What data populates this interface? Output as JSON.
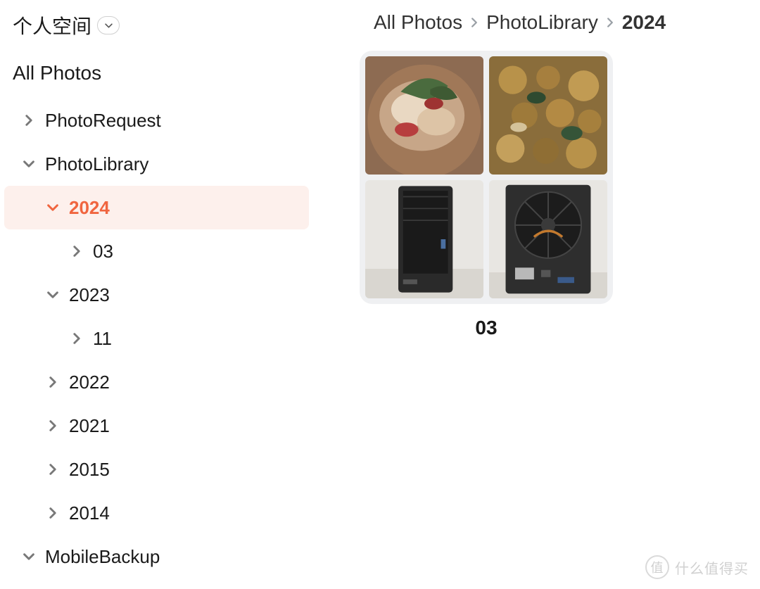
{
  "header": {
    "space_label": "个人空间"
  },
  "sidebar": {
    "root": "All Photos",
    "items": [
      {
        "label": "PhotoRequest",
        "expanded": false,
        "level": 1,
        "active": false
      },
      {
        "label": "PhotoLibrary",
        "expanded": true,
        "level": 1,
        "active": false
      },
      {
        "label": "2024",
        "expanded": true,
        "level": 2,
        "active": true
      },
      {
        "label": "03",
        "expanded": false,
        "level": 3,
        "active": false
      },
      {
        "label": "2023",
        "expanded": true,
        "level": 2,
        "active": false
      },
      {
        "label": "11",
        "expanded": false,
        "level": 3,
        "active": false
      },
      {
        "label": "2022",
        "expanded": false,
        "level": 2,
        "active": false
      },
      {
        "label": "2021",
        "expanded": false,
        "level": 2,
        "active": false
      },
      {
        "label": "2015",
        "expanded": false,
        "level": 2,
        "active": false
      },
      {
        "label": "2014",
        "expanded": false,
        "level": 2,
        "active": false
      },
      {
        "label": "MobileBackup",
        "expanded": true,
        "level": 1,
        "active": false
      }
    ]
  },
  "breadcrumb": {
    "items": [
      "All Photos",
      "PhotoLibrary",
      "2024"
    ]
  },
  "folder": {
    "name": "03",
    "thumbs": [
      "food-dish",
      "seafood-mix",
      "nas-front",
      "nas-back-fan"
    ]
  },
  "watermark": {
    "badge": "值",
    "text": "什么值得买"
  }
}
